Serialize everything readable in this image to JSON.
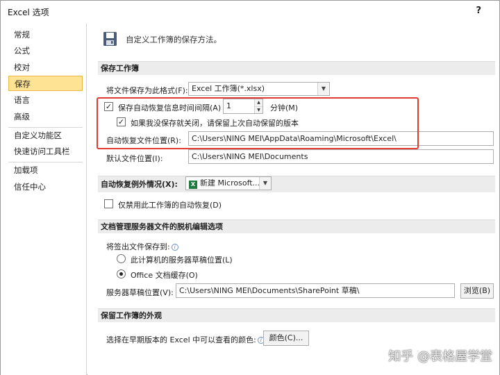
{
  "window": {
    "title": "Excel 选项",
    "help": "?"
  },
  "sidebar": {
    "items": [
      {
        "label": "常规"
      },
      {
        "label": "公式"
      },
      {
        "label": "校对"
      },
      {
        "label": "保存"
      },
      {
        "label": "语言"
      },
      {
        "label": "高级"
      },
      {
        "label": "自定义功能区"
      },
      {
        "label": "快速访问工具栏"
      },
      {
        "label": "加载项"
      },
      {
        "label": "信任中心"
      }
    ],
    "selected": "保存"
  },
  "header": {
    "text": "自定义工作簿的保存方法。"
  },
  "save_workbooks": {
    "section_title": "保存工作簿",
    "format_label": "将文件保存为此格式(F):",
    "format_value": "Excel 工作簿(*.xlsx)",
    "autorecover_label": "保存自动恢复信息时间间隔(A)",
    "autorecover_checked": true,
    "autorecover_minutes": "1",
    "minutes_label": "分钟(M)",
    "keep_version_label": "如果我没保存就关闭，请保留上次自动保留的版本",
    "keep_version_checked": true,
    "autorecover_location_label": "自动恢复文件位置(R):",
    "autorecover_location_value": "C:\\Users\\NING MEI\\AppData\\Roaming\\Microsoft\\Excel\\",
    "default_location_label": "默认文件位置(I):",
    "default_location_value": "C:\\Users\\NING MEI\\Documents"
  },
  "autorecover_exceptions": {
    "section_title": "自动恢复例外情况(X):",
    "workbook_value": "新建 Microsoft...",
    "disable_label": "仅禁用此工作簿的自动恢复(D)",
    "disable_checked": false
  },
  "offline_editing": {
    "section_title": "文档管理服务器文件的脱机编辑选项",
    "checkout_label": "将签出文件保存到:",
    "option_server": "此计算机的服务器草稿位置(L)",
    "option_cache": "Office 文档缓存(O)",
    "selected_option": "Office 文档缓存(O)",
    "drafts_label": "服务器草稿位置(V):",
    "drafts_value": "C:\\Users\\NING MEI\\Documents\\SharePoint 草稿\\",
    "browse_label": "浏览(B)"
  },
  "appearance": {
    "section_title": "保留工作簿的外观",
    "colors_label": "选择在早期版本的 Excel 中可以查看的颜色:",
    "colors_button": "颜色(C)..."
  },
  "watermark": "知乎 @表格屋学堂",
  "colors": {
    "highlight": "#fde393",
    "annotation": "#e23a2f",
    "section_bg": "#ececec"
  }
}
